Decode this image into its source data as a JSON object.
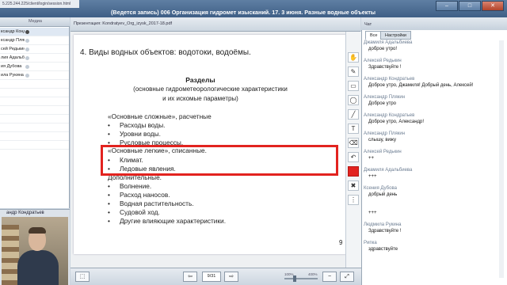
{
  "window": {
    "url": "5.225.244.225/client/login/session.html",
    "title": "(Ведется запись) 006 Организация гидромет изысканий. 17. 3 июня. Разные водные объекты",
    "minimize_label": "–",
    "maximize_label": "□",
    "close_label": "✕"
  },
  "participants": {
    "col_name": "",
    "col_media": "Медиа",
    "rows": [
      "ксандр Кондра",
      "ксандр Плякин",
      "сей Редькин",
      "лия Адальбиева",
      "ия Дубова",
      "ила Рукина",
      "",
      "",
      "",
      "",
      "",
      "",
      "",
      ""
    ]
  },
  "camera": {
    "label": "андр Кондратьев"
  },
  "document": {
    "file_name": "Презентация: Kondratyev_Org_izysk_2017-18.pdf",
    "heading": "4. Виды водных объектов: водотоки, водоёмы.",
    "section_title": "Разделы",
    "section_sub1": "(основные гидрометеорологические характеристики",
    "section_sub2": "и их искомые параметры)",
    "complex_header": "«Основные сложные», расчетные",
    "complex_items": [
      "Расходы воды.",
      "Уровни воды.",
      "Русловые процессы."
    ],
    "light_header": "«Основные легкие», списанные.",
    "light_items": [
      "Климат.",
      "Ледовые явления."
    ],
    "extra_header": "Дополнительные.",
    "extra_items": [
      "Волнение.",
      "Расход наносов.",
      "Водная растительность.",
      "Судовой ход.",
      "Другие влияющие характеристики."
    ],
    "bullet": "•",
    "page_number": "9"
  },
  "nav": {
    "page_counter": "9/31",
    "zoom_min": "100%",
    "zoom_max": "400%",
    "zoom_level_fraction": 0.3
  },
  "tools": {
    "icons": [
      "hand-icon",
      "pencil-icon",
      "rectangle-icon",
      "ellipse-icon",
      "line-icon",
      "text-icon",
      "eraser-icon",
      "undo-icon",
      "color-swatch-icon",
      "delete-icon",
      "more-icon"
    ],
    "glyphs": [
      "✋",
      "✎",
      "▭",
      "◯",
      "╱",
      "T",
      "⌫",
      "↶",
      "",
      "✖",
      "⋮"
    ],
    "active_color": "#e2231f"
  },
  "chat": {
    "title": "Чат",
    "tab_all": "Все",
    "tab_settings": "Настройки",
    "messages": [
      {
        "author": "Джамиля Адальбиева",
        "text": "доброе утро!"
      },
      {
        "author": "Алексей Редькин",
        "text": "Здравствуйте !"
      },
      {
        "author": "Александр Кондратьев",
        "text": "Доброе утро, Джамиля! Добрый день, Алексей!"
      },
      {
        "author": "Александр Плякин",
        "text": "Доброе утро"
      },
      {
        "author": "Александр Кондратьев",
        "text": "Доброе утро, Александр!"
      },
      {
        "author": "Александр Плякин",
        "text": "слышу, вижу"
      },
      {
        "author": "Алексей Редькин",
        "text": "++"
      },
      {
        "author": "Джамиля Адальбиева",
        "text": "+++"
      },
      {
        "author": "Ксения Дубова",
        "text": "добрый день"
      },
      {
        "author": "",
        "text": "+++"
      },
      {
        "author": "Людмила Рукина",
        "text": "Здравствуйте !"
      },
      {
        "author": "Рипка",
        "text": "здравствуйте"
      }
    ]
  }
}
